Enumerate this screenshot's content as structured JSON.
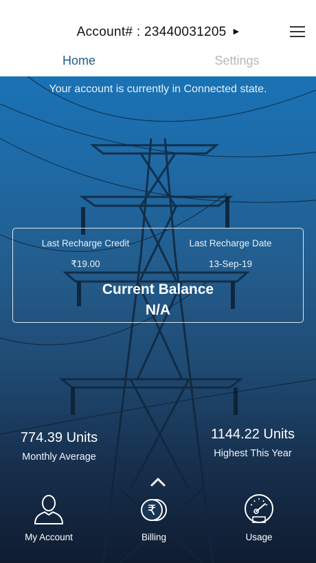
{
  "header": {
    "account_label": "Account# : 23440031205",
    "caret_icon": "caret-right-icon",
    "menu_icon": "hamburger-menu-icon"
  },
  "tabs": [
    {
      "label": "Home",
      "active": true
    },
    {
      "label": "Settings",
      "active": false
    }
  ],
  "status_message": "Your account is currently in Connected state.",
  "card": {
    "last_recharge_credit_label": "Last Recharge Credit",
    "last_recharge_credit_value": "₹19.00",
    "last_recharge_date_label": "Last Recharge Date",
    "last_recharge_date_value": "13-Sep-19",
    "current_balance_label": "Current Balance",
    "current_balance_value": "N/A"
  },
  "stats": {
    "monthly_average_value": "774.39 Units",
    "monthly_average_label": "Monthly Average",
    "highest_year_value": "1144.22 Units",
    "highest_year_label": "Highest This Year"
  },
  "bottom_nav": [
    {
      "label": "My Account",
      "icon": "user-icon"
    },
    {
      "label": "Billing",
      "icon": "rupee-coins-icon"
    },
    {
      "label": "Usage",
      "icon": "speedometer-icon"
    }
  ],
  "colors": {
    "active_tab": "#1f5e8c",
    "inactive_tab": "#b7b7b7",
    "hero_top": "#1a72b5",
    "hero_bottom": "#0f1c30"
  }
}
